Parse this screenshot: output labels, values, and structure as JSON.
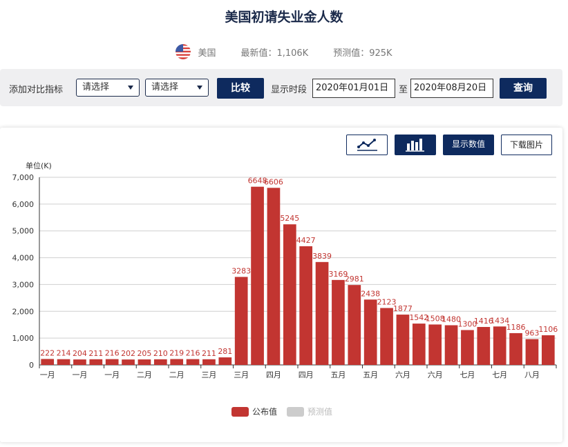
{
  "page": {
    "title": "美国初请失业金人数",
    "country": "美国",
    "latest": "最新值：1,106K",
    "forecast": "预测值：925K"
  },
  "toolbar": {
    "add_compare_label": "添加对比指标",
    "select1": "请选择",
    "select2": "请选择",
    "compare_button": "比较",
    "period_label": "显示时段",
    "start_date": "2020年01月01日",
    "to_label": "至",
    "end_date": "2020年08月20日",
    "query_button": "查询"
  },
  "chart_toolbar": {
    "line_icon": "line-chart-icon",
    "bar_icon": "bar-chart-icon",
    "show_values": "显示数值",
    "download": "下载图片"
  },
  "chart_data": {
    "type": "bar",
    "ylabel": "单位(K)",
    "ylim": [
      0,
      7000
    ],
    "yticks": [
      "0",
      "1,000",
      "2,000",
      "3,000",
      "4,000",
      "5,000",
      "6,000",
      "7,000"
    ],
    "x_tick_labels": [
      "一月",
      "一月",
      "一月",
      "二月",
      "二月",
      "三月",
      "三月",
      "四月",
      "四月",
      "五月",
      "五月",
      "六月",
      "六月",
      "七月",
      "七月",
      "八月"
    ],
    "grid": true,
    "legend_position": "bottom",
    "series": [
      {
        "name": "公布值",
        "color": "#c23531",
        "values": [
          222,
          214,
          204,
          211,
          216,
          202,
          205,
          210,
          219,
          216,
          211,
          281,
          3283,
          6648,
          6606,
          5245,
          4427,
          3839,
          3169,
          2981,
          2438,
          2123,
          1877,
          1542,
          1508,
          1480,
          1300,
          1416,
          1434,
          1186,
          963,
          1106
        ]
      },
      {
        "name": "预测值",
        "color": "#cccccc",
        "values": []
      }
    ]
  }
}
